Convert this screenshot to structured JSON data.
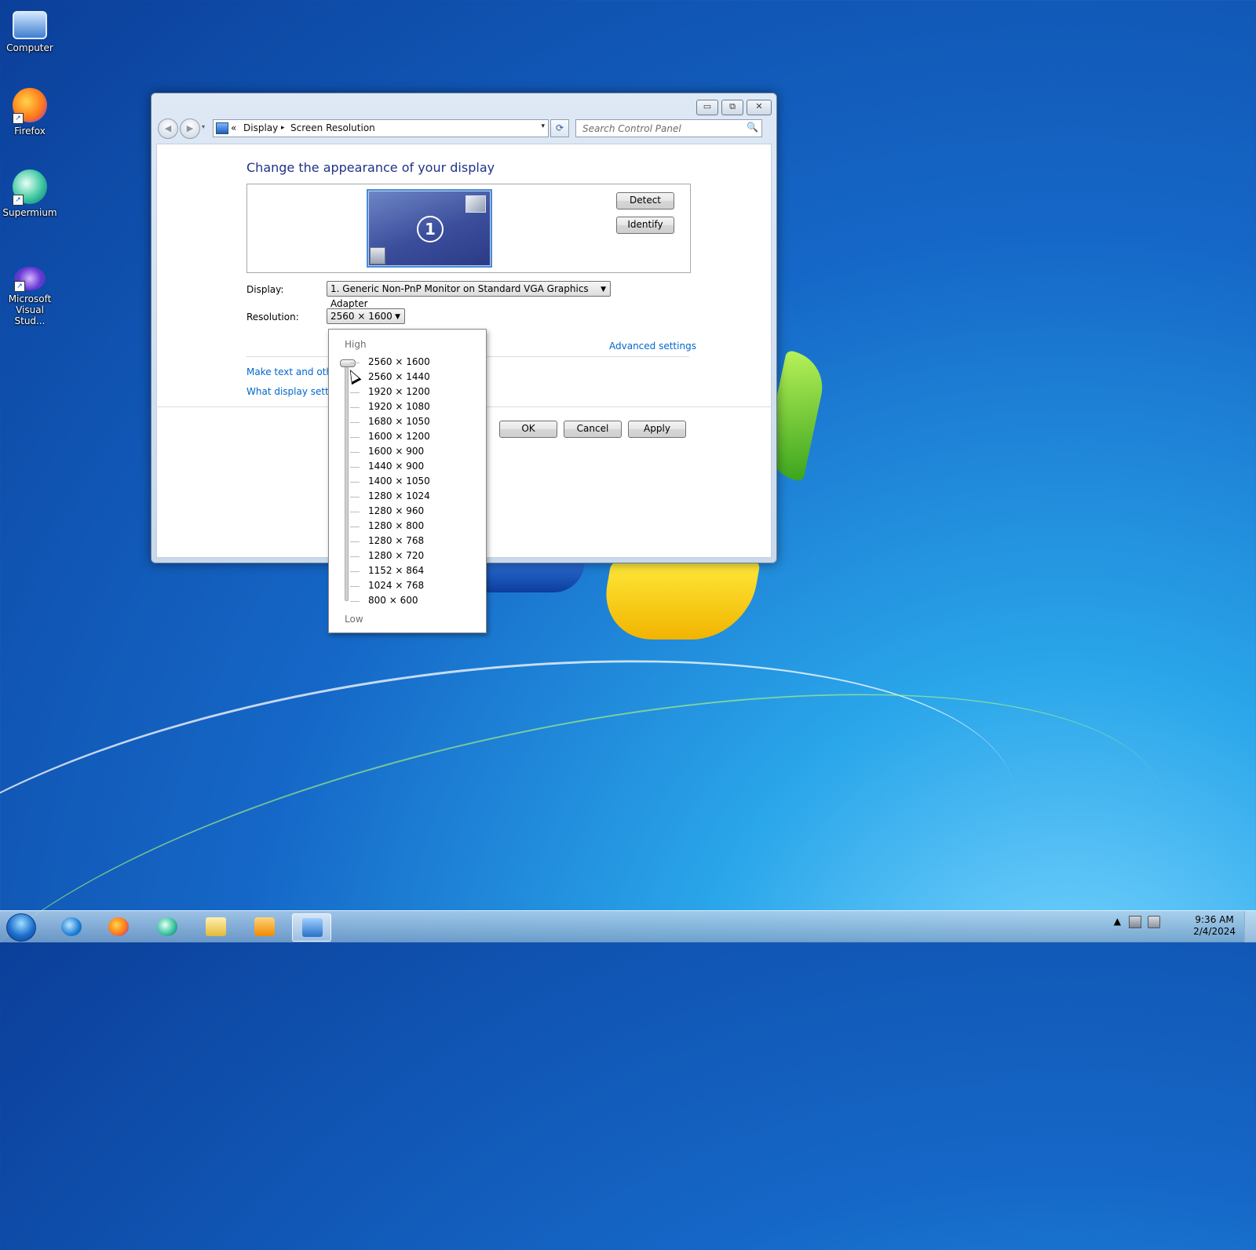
{
  "desktop": {
    "icons": [
      {
        "label": "Computer"
      },
      {
        "label": "Firefox"
      },
      {
        "label": "Supermium"
      },
      {
        "label": "Microsoft Visual Stud..."
      }
    ]
  },
  "window": {
    "controls": {
      "minimize": "▭",
      "maximize": "⧉",
      "close": "✕"
    },
    "nav": {
      "back": "◀",
      "forward": "▶",
      "recent": "▾"
    },
    "breadcrumb": {
      "overflow": "«",
      "items": [
        "Display",
        "Screen Resolution"
      ],
      "separator": "▸",
      "dropdown": "▾"
    },
    "refresh_glyph": "⟳",
    "search": {
      "placeholder": "Search Control Panel",
      "icon": "🔍"
    },
    "title": "Change the appearance of your display",
    "preview": {
      "monitor_number": "1"
    },
    "buttons": {
      "detect": "Detect",
      "identify": "Identify",
      "ok": "OK",
      "cancel": "Cancel",
      "apply": "Apply"
    },
    "display": {
      "label": "Display:",
      "value": "1. Generic Non-PnP Monitor on Standard VGA Graphics Adapter"
    },
    "resolution": {
      "label": "Resolution:",
      "value": "2560 × 1600"
    },
    "links": {
      "advanced": "Advanced settings",
      "text_size": "Make text and other",
      "which_settings": "What display setting"
    }
  },
  "resolution_dropdown": {
    "high_label": "High",
    "low_label": "Low",
    "options": [
      "2560 × 1600",
      "2560 × 1440",
      "1920 × 1200",
      "1920 × 1080",
      "1680 × 1050",
      "1600 × 1200",
      "1600 × 900",
      "1440 × 900",
      "1400 × 1050",
      "1280 × 1024",
      "1280 × 960",
      "1280 × 800",
      "1280 × 768",
      "1280 × 720",
      "1152 × 864",
      "1024 × 768",
      "800 × 600"
    ],
    "selected_index": 0
  },
  "taskbar": {
    "tray_arrow": "▲",
    "time": "9:36 AM",
    "date": "2/4/2024"
  },
  "colors": {
    "title_blue": "#1e3287",
    "link_blue": "#0066cc",
    "desktop_blue": "#1567c7"
  }
}
